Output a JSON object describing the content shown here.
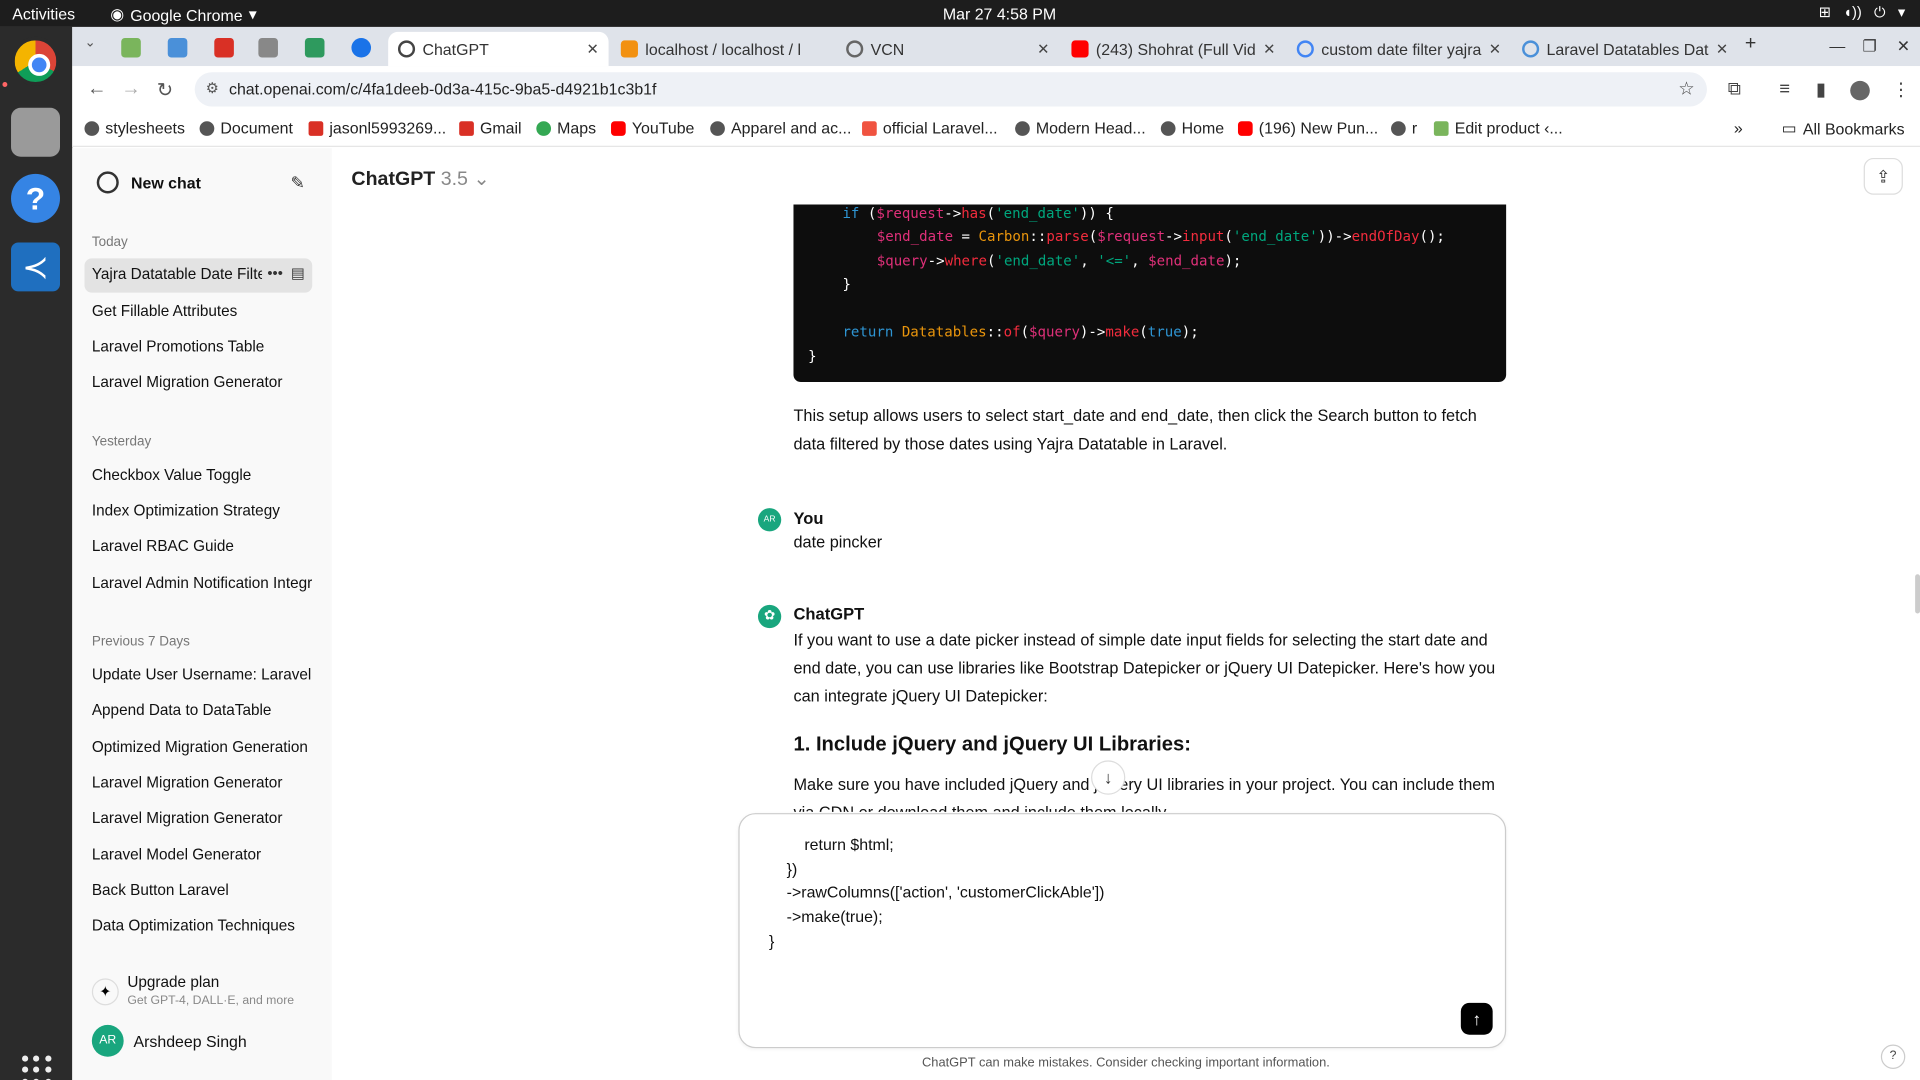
{
  "os": {
    "activities": "Activities",
    "app_name": "Google Chrome",
    "clock": "Mar 27  4:58 PM"
  },
  "tabs": [
    {
      "title": "ChatGPT"
    },
    {
      "title": "localhost / localhost / l"
    },
    {
      "title": "VCN"
    },
    {
      "title": "(243) Shohrat (Full Vid"
    },
    {
      "title": "custom date filter yajra"
    },
    {
      "title": "Laravel Datatables Dat"
    }
  ],
  "address": {
    "url": "chat.openai.com/c/4fa1deeb-0d3a-415c-9ba5-d4921b1c3b1f"
  },
  "bookmarks": [
    {
      "label": "stylesheets",
      "color": "#555555"
    },
    {
      "label": "Document",
      "color": "#555555"
    },
    {
      "label": "jasonl5993269...",
      "color": "#d93025"
    },
    {
      "label": "Gmail",
      "color": "#d93025"
    },
    {
      "label": "Maps",
      "color": "#34a853"
    },
    {
      "label": "YouTube",
      "color": "#ff0000"
    },
    {
      "label": "Apparel and ac...",
      "color": "#555555"
    },
    {
      "label": "official Laravel...",
      "color": "#f05340"
    },
    {
      "label": "Modern Head...",
      "color": "#555555"
    },
    {
      "label": "Home",
      "color": "#555555"
    },
    {
      "label": "(196) New Pun...",
      "color": "#ff0000"
    },
    {
      "label": "r",
      "color": "#555555"
    },
    {
      "label": "Edit product ‹...",
      "color": "#7ab55c"
    }
  ],
  "all_bookmarks": "All Bookmarks",
  "sidebar": {
    "new_chat": "New chat",
    "today_label": "Today",
    "today": [
      "Yajra Datatable Date Filter",
      "Get Fillable Attributes",
      "Laravel Promotions Table",
      "Laravel Migration Generator"
    ],
    "yesterday_label": "Yesterday",
    "yesterday": [
      "Checkbox Value Toggle",
      "Index Optimization Strategy",
      "Laravel RBAC Guide",
      "Laravel Admin Notification Integra"
    ],
    "prev7_label": "Previous 7 Days",
    "prev7": [
      "Update User Username: Laravel",
      "Append Data to DataTable",
      "Optimized Migration Generation",
      "Laravel Migration Generator",
      "Laravel Migration Generator",
      "Laravel Model Generator",
      "Back Button Laravel",
      "Data Optimization Techniques"
    ],
    "upgrade_title": "Upgrade plan",
    "upgrade_sub": "Get GPT-4, DALL·E, and more",
    "user_initials": "AR",
    "user_name": "Arshdeep Singh"
  },
  "main": {
    "model_name": "ChatGPT",
    "model_version": "3.5",
    "code_lines": [
      "if ($request->has('end_date')) {",
      "    $end_date = Carbon::parse($request->input('end_date'))->endOfDay();",
      "    $query->where('end_date', '<=', $end_date);",
      "}",
      "",
      "return Datatables::of($query)->make(true);",
      "}"
    ],
    "para1": "This setup allows users to select start_date and end_date, then click the Search button to fetch data filtered by those dates using Yajra Datatable in Laravel.",
    "you_initials": "AR",
    "you_name": "You",
    "you_message": "date pincker",
    "bot_name": "ChatGPT",
    "bot_message": "If you want to use a date picker instead of simple date input fields for selecting the start date and end date, you can use libraries like Bootstrap Datepicker or jQuery UI Datepicker. Here's how you can integrate jQuery UI Datepicker:",
    "heading": "1. Include jQuery and jQuery UI Libraries:",
    "para2": "Make sure you have included jQuery and jQuery UI libraries in your project. You can include them via CDN or download them and include them locally."
  },
  "composer": {
    "lines": [
      "        return $html;",
      "    })",
      "    ->rawColumns(['action', 'customerClickAble'])",
      "    ->make(true);",
      "}"
    ]
  },
  "disclaimer": "ChatGPT can make mistakes. Consider checking important information."
}
